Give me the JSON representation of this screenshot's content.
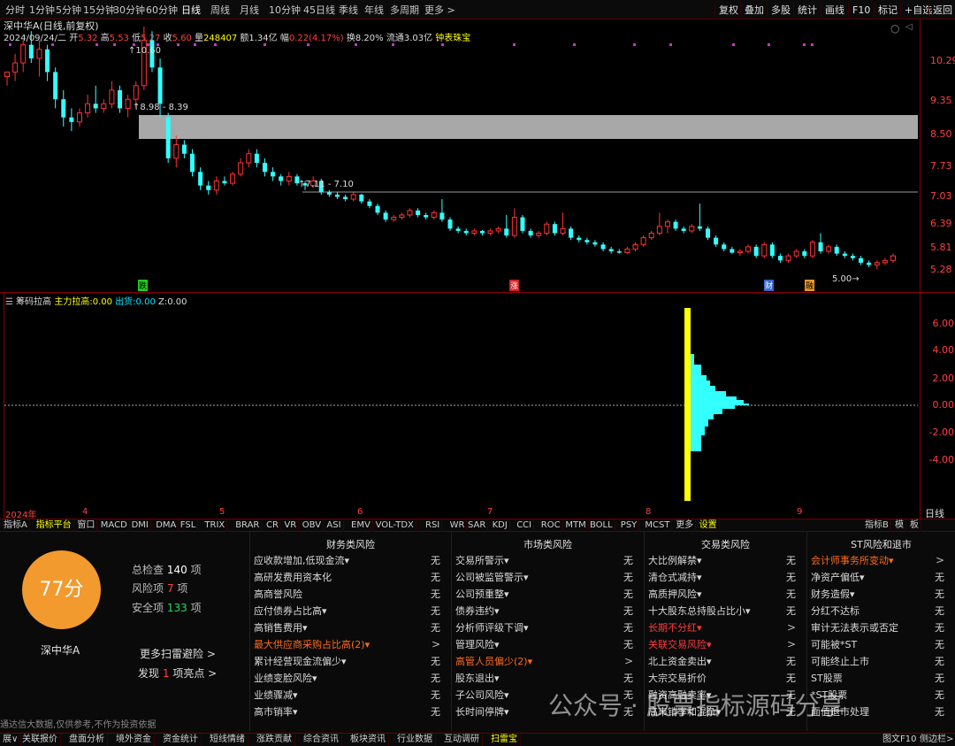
{
  "topbar": {
    "periods": [
      "分时",
      "1分钟",
      "5分钟",
      "15分钟",
      "30分钟",
      "60分钟",
      "日线",
      "周线",
      "月线",
      "10分钟",
      "45日线",
      "季线",
      "年线",
      "多周期",
      "更多 >"
    ],
    "right_buttons": [
      "复权",
      "叠加",
      "多股",
      "统计",
      "画线",
      "F10",
      "标记",
      "+自选",
      "返回"
    ]
  },
  "title": "深中华A(日线,前复权)",
  "info": {
    "date": "2024/09/24/二",
    "open_l": "开",
    "open": "5.32",
    "high_l": "高",
    "high": "5.53",
    "low_l": "低",
    "low": "5.27",
    "close_l": "收",
    "close": "5.60",
    "vol_l": "量",
    "vol": "248407",
    "amt_l": "额",
    "amt": "1.34亿",
    "chg_l": "幅",
    "chg": "0.22(4.17%)",
    "turn_l": "换",
    "turn": "8.20%",
    "float_l": "流通",
    "float": "3.03亿",
    "extra": "钟表珠宝"
  },
  "price_axis": [
    "10.29",
    "9.35",
    "8.50",
    "7.73",
    "7.03",
    "6.39",
    "5.81",
    "5.28"
  ],
  "annotations": {
    "high": "10.60",
    "zone": "8.98 - 8.39",
    "level": "7.11 - 7.10",
    "low": "5.00"
  },
  "markers": {
    "die": "跌",
    "zhang": "涨",
    "cai": "财",
    "rong": "融"
  },
  "indicator": {
    "name": "筹码拉高",
    "main_l": "主力拉高:",
    "main": "0.00",
    "out_l": "出货:",
    "out": "0.00",
    "z_l": "Z:",
    "z": "0.00"
  },
  "ind_axis": [
    "6.00",
    "4.00",
    "2.00",
    "0.00",
    "-2.00",
    "-4.00"
  ],
  "x_axis": [
    "2024年",
    "4",
    "5",
    "6",
    "7",
    "8",
    "9"
  ],
  "corner": "日线",
  "chart_data": [
    {
      "type": "candlestick",
      "title": "深中华A(日线,前复权)",
      "ylim": [
        4.9,
        11.0
      ],
      "y_ticks": [
        10.29,
        9.35,
        8.5,
        7.73,
        7.03,
        6.39,
        5.81,
        5.28
      ],
      "note": "approximate daily candles Mar–Sep 2024",
      "candles": [
        [
          9.5,
          9.6,
          9.3,
          9.6
        ],
        [
          9.6,
          10.0,
          9.4,
          9.8
        ],
        [
          9.8,
          10.3,
          9.6,
          10.2
        ],
        [
          10.2,
          10.5,
          9.8,
          9.9
        ],
        [
          9.9,
          10.3,
          9.5,
          10.1
        ],
        [
          10.1,
          10.2,
          9.4,
          9.6
        ],
        [
          9.6,
          9.7,
          8.8,
          9.0
        ],
        [
          9.0,
          9.2,
          8.4,
          8.6
        ],
        [
          8.6,
          8.8,
          8.3,
          8.5
        ],
        [
          8.5,
          8.8,
          8.4,
          8.7
        ],
        [
          8.7,
          9.1,
          8.6,
          8.9
        ],
        [
          8.9,
          9.3,
          8.7,
          8.8
        ],
        [
          8.8,
          9.0,
          8.7,
          8.9
        ],
        [
          8.9,
          9.4,
          8.8,
          9.2
        ],
        [
          9.2,
          9.3,
          8.7,
          8.8
        ],
        [
          8.8,
          9.1,
          8.6,
          9.0
        ],
        [
          9.0,
          9.4,
          8.8,
          9.3
        ],
        [
          9.3,
          10.6,
          9.2,
          10.3
        ],
        [
          10.3,
          10.5,
          9.6,
          9.7
        ],
        [
          9.7,
          9.9,
          8.6,
          8.9
        ],
        [
          8.6,
          8.7,
          7.6,
          7.7
        ],
        [
          7.7,
          8.2,
          7.5,
          8.0
        ],
        [
          8.0,
          8.1,
          7.7,
          7.8
        ],
        [
          7.8,
          7.9,
          7.3,
          7.4
        ],
        [
          7.4,
          7.5,
          7.0,
          7.1
        ],
        [
          7.1,
          7.2,
          6.9,
          7.0
        ],
        [
          7.0,
          7.3,
          6.9,
          7.2
        ],
        [
          7.2,
          7.3,
          7.1,
          7.15
        ],
        [
          7.15,
          7.4,
          7.1,
          7.35
        ],
        [
          7.35,
          7.7,
          7.3,
          7.6
        ],
        [
          7.6,
          7.9,
          7.5,
          7.8
        ],
        [
          7.8,
          7.9,
          7.5,
          7.6
        ],
        [
          7.6,
          7.7,
          7.3,
          7.4
        ],
        [
          7.4,
          7.5,
          7.2,
          7.3
        ],
        [
          7.3,
          7.35,
          7.1,
          7.2
        ],
        [
          7.2,
          7.4,
          7.1,
          7.3
        ],
        [
          7.3,
          7.35,
          7.1,
          7.15
        ],
        [
          7.15,
          7.2,
          7.0,
          7.1
        ],
        [
          7.1,
          7.3,
          7.05,
          7.2
        ],
        [
          7.2,
          7.25,
          6.9,
          6.95
        ],
        [
          6.95,
          7.0,
          6.85,
          6.9
        ],
        [
          6.9,
          6.95,
          6.8,
          6.85
        ],
        [
          6.85,
          6.9,
          6.75,
          6.8
        ],
        [
          6.8,
          6.95,
          6.75,
          6.9
        ],
        [
          6.9,
          6.92,
          6.7,
          6.75
        ],
        [
          6.75,
          6.8,
          6.6,
          6.65
        ],
        [
          6.65,
          6.7,
          6.45,
          6.5
        ],
        [
          6.5,
          6.55,
          6.3,
          6.35
        ],
        [
          6.35,
          6.45,
          6.3,
          6.4
        ],
        [
          6.4,
          6.5,
          6.35,
          6.45
        ],
        [
          6.45,
          6.6,
          6.4,
          6.55
        ],
        [
          6.55,
          6.6,
          6.4,
          6.45
        ],
        [
          6.45,
          6.5,
          6.35,
          6.4
        ],
        [
          6.4,
          6.55,
          6.35,
          6.5
        ],
        [
          6.5,
          6.8,
          6.3,
          6.35
        ],
        [
          6.35,
          6.4,
          6.1,
          6.15
        ],
        [
          6.15,
          6.2,
          6.05,
          6.1
        ],
        [
          6.1,
          6.15,
          6.0,
          6.05
        ],
        [
          6.05,
          6.15,
          6.0,
          6.1
        ],
        [
          6.1,
          6.12,
          6.0,
          6.05
        ],
        [
          6.05,
          6.15,
          6.0,
          6.1
        ],
        [
          6.1,
          6.2,
          6.05,
          6.15
        ],
        [
          6.15,
          6.45,
          5.95,
          6.0
        ],
        [
          6.0,
          6.6,
          5.95,
          6.4
        ],
        [
          6.4,
          6.45,
          6.05,
          6.1
        ],
        [
          6.1,
          6.15,
          5.95,
          6.0
        ],
        [
          6.0,
          6.1,
          5.95,
          6.05
        ],
        [
          6.05,
          6.3,
          6.0,
          6.25
        ],
        [
          6.25,
          6.3,
          6.0,
          6.05
        ],
        [
          6.05,
          6.5,
          6.0,
          6.15
        ],
        [
          6.15,
          6.2,
          5.9,
          5.95
        ],
        [
          5.95,
          6.0,
          5.85,
          5.9
        ],
        [
          5.9,
          5.95,
          5.8,
          5.85
        ],
        [
          5.85,
          5.9,
          5.75,
          5.8
        ],
        [
          5.8,
          5.85,
          5.65,
          5.7
        ],
        [
          5.7,
          5.75,
          5.6,
          5.65
        ],
        [
          5.65,
          5.7,
          5.6,
          5.62
        ],
        [
          5.62,
          5.75,
          5.6,
          5.7
        ],
        [
          5.7,
          5.85,
          5.65,
          5.8
        ],
        [
          5.8,
          6.0,
          5.75,
          5.95
        ],
        [
          5.95,
          6.1,
          5.9,
          6.05
        ],
        [
          6.05,
          6.5,
          6.0,
          6.2
        ],
        [
          6.2,
          6.35,
          6.05,
          6.3
        ],
        [
          6.3,
          6.35,
          6.1,
          6.15
        ],
        [
          6.15,
          6.2,
          6.05,
          6.1
        ],
        [
          6.1,
          6.25,
          6.05,
          6.2
        ],
        [
          6.2,
          6.7,
          6.1,
          6.15
        ],
        [
          6.15,
          6.2,
          5.9,
          5.95
        ],
        [
          5.95,
          6.0,
          5.75,
          5.8
        ],
        [
          5.8,
          5.85,
          5.65,
          5.7
        ],
        [
          5.7,
          5.75,
          5.6,
          5.62
        ],
        [
          5.62,
          5.7,
          5.55,
          5.65
        ],
        [
          5.65,
          5.8,
          5.6,
          5.75
        ],
        [
          5.75,
          5.8,
          5.5,
          5.55
        ],
        [
          5.55,
          5.85,
          5.5,
          5.8
        ],
        [
          5.8,
          5.85,
          5.5,
          5.55
        ],
        [
          5.55,
          5.6,
          5.4,
          5.45
        ],
        [
          5.45,
          5.6,
          5.4,
          5.55
        ],
        [
          5.55,
          5.7,
          5.5,
          5.65
        ],
        [
          5.65,
          5.7,
          5.5,
          5.55
        ],
        [
          5.55,
          5.9,
          5.5,
          5.85
        ],
        [
          5.85,
          6.05,
          5.6,
          5.65
        ],
        [
          5.65,
          5.8,
          5.6,
          5.75
        ],
        [
          5.75,
          5.8,
          5.55,
          5.6
        ],
        [
          5.6,
          5.65,
          5.5,
          5.55
        ],
        [
          5.55,
          5.6,
          5.45,
          5.5
        ],
        [
          5.5,
          5.55,
          5.35,
          5.4
        ],
        [
          5.4,
          5.45,
          5.3,
          5.35
        ],
        [
          5.35,
          5.45,
          5.25,
          5.4
        ],
        [
          5.4,
          5.5,
          5.35,
          5.45
        ],
        [
          5.45,
          5.6,
          5.4,
          5.55
        ]
      ]
    },
    {
      "type": "bar",
      "title": "筹码拉高",
      "ylim": [
        -7.5,
        7.5
      ],
      "y_ticks": [
        6,
        4,
        2,
        0,
        -2,
        -4
      ],
      "note": "horizontal chip distribution near x=8 month"
    }
  ],
  "panel": {
    "score": "77分",
    "stock": "深中华A",
    "total_l": "总检查",
    "total": "140",
    "total_u": "项",
    "risk_l": "风险项",
    "risk": "7",
    "risk_u": "项",
    "safe_l": "安全项",
    "safe": "133",
    "safe_u": "项",
    "more": "更多扫雷避险 >",
    "find_l": "发现",
    "find": "1",
    "find_u": "项亮点 >",
    "disclaimer": "通达信大数据,仅供参考,不作为投资依据",
    "cols": [
      {
        "title": "财务类风险",
        "rows": [
          {
            "label": "应收款增加,低现金流▾",
            "value": "无"
          },
          {
            "label": "高研发费用资本化",
            "value": "无"
          },
          {
            "label": "高商誉风险",
            "value": "无"
          },
          {
            "label": "应付债券占比高▾",
            "value": "无"
          },
          {
            "label": "高销售费用▾",
            "value": "无"
          },
          {
            "label": "最大供应商采购占比高(2)▾",
            "value": ">",
            "hl": "orange"
          },
          {
            "label": "累计经营现金流偏少▾",
            "value": "无"
          },
          {
            "label": "业绩变脸风险▾",
            "value": "无"
          },
          {
            "label": "业绩骤减▾",
            "value": "无"
          },
          {
            "label": "高市销率▾",
            "value": "无"
          }
        ]
      },
      {
        "title": "市场类风险",
        "rows": [
          {
            "label": "交易所警示▾",
            "value": "无"
          },
          {
            "label": "公司被监管警示▾",
            "value": "无"
          },
          {
            "label": "公司预重整▾",
            "value": "无"
          },
          {
            "label": "债券违约▾",
            "value": "无"
          },
          {
            "label": "分析师评级下调▾",
            "value": "无"
          },
          {
            "label": "管理风险▾",
            "value": "无"
          },
          {
            "label": "高管人员偏少(2)▾",
            "value": ">",
            "hl": "orange"
          },
          {
            "label": "股东退出▾",
            "value": "无"
          },
          {
            "label": "子公司风险▾",
            "value": "无"
          },
          {
            "label": "长时间停牌▾",
            "value": "无"
          }
        ]
      },
      {
        "title": "交易类风险",
        "rows": [
          {
            "label": "大比例解禁▾",
            "value": "无"
          },
          {
            "label": "清仓式减持▾",
            "value": "无"
          },
          {
            "label": "高质押风险▾",
            "value": "无"
          },
          {
            "label": "十大股东总持股占比小▾",
            "value": "无"
          },
          {
            "label": "长期不分红▾",
            "value": ">",
            "hl": "red"
          },
          {
            "label": "关联交易风险▾",
            "value": ">",
            "hl": "red"
          },
          {
            "label": "北上资金卖出▾",
            "value": "无"
          },
          {
            "label": "大宗交易折价",
            "value": "无"
          },
          {
            "label": "融资高融卖率▾",
            "value": "无"
          },
          {
            "label": "高市销率和混杂▾",
            "value": "无"
          }
        ]
      },
      {
        "title": "ST风险和退市",
        "rows": [
          {
            "label": "会计师事务所变动▾",
            "value": ">",
            "hl": "orange"
          },
          {
            "label": "净资产偏低▾",
            "value": "无"
          },
          {
            "label": "财务造假▾",
            "value": "无"
          },
          {
            "label": "分红不达标",
            "value": "无"
          },
          {
            "label": "审计无法表示或否定",
            "value": "无"
          },
          {
            "label": "可能被*ST",
            "value": "无"
          },
          {
            "label": "可能终止上市",
            "value": "无"
          },
          {
            "label": "ST股票",
            "value": "无"
          },
          {
            "label": "*ST股票",
            "value": "无"
          },
          {
            "label": "面值退市处理",
            "value": "无"
          }
        ]
      }
    ]
  },
  "tabs1": [
    "指标A",
    "指标平台",
    "窗口",
    "MACD",
    "DMI",
    "DMA",
    "FSL",
    "TRIX",
    "BRAR",
    "CR",
    "VR",
    "OBV",
    "ASI",
    "EMV",
    "VOL-TDX",
    "RSI",
    "WR",
    "SAR",
    "KDJ",
    "CCI",
    "ROC",
    "MTM",
    "BOLL",
    "PSY",
    "MCST",
    "更多",
    "设置"
  ],
  "tabs1_right": [
    "指标B",
    "模",
    "板"
  ],
  "tabs2": [
    "展∨",
    "关联报价",
    "盘面分析",
    "境外资金",
    "资金统计",
    "短线情绪",
    "涨跌贡献",
    "综合资讯",
    "板块资讯",
    "行业数据",
    "互动调研",
    "扫雷宝"
  ],
  "tabs2_right": [
    "图文F10",
    "侧边栏>"
  ],
  "watermark": "公众号 · 股票指标源码分享"
}
